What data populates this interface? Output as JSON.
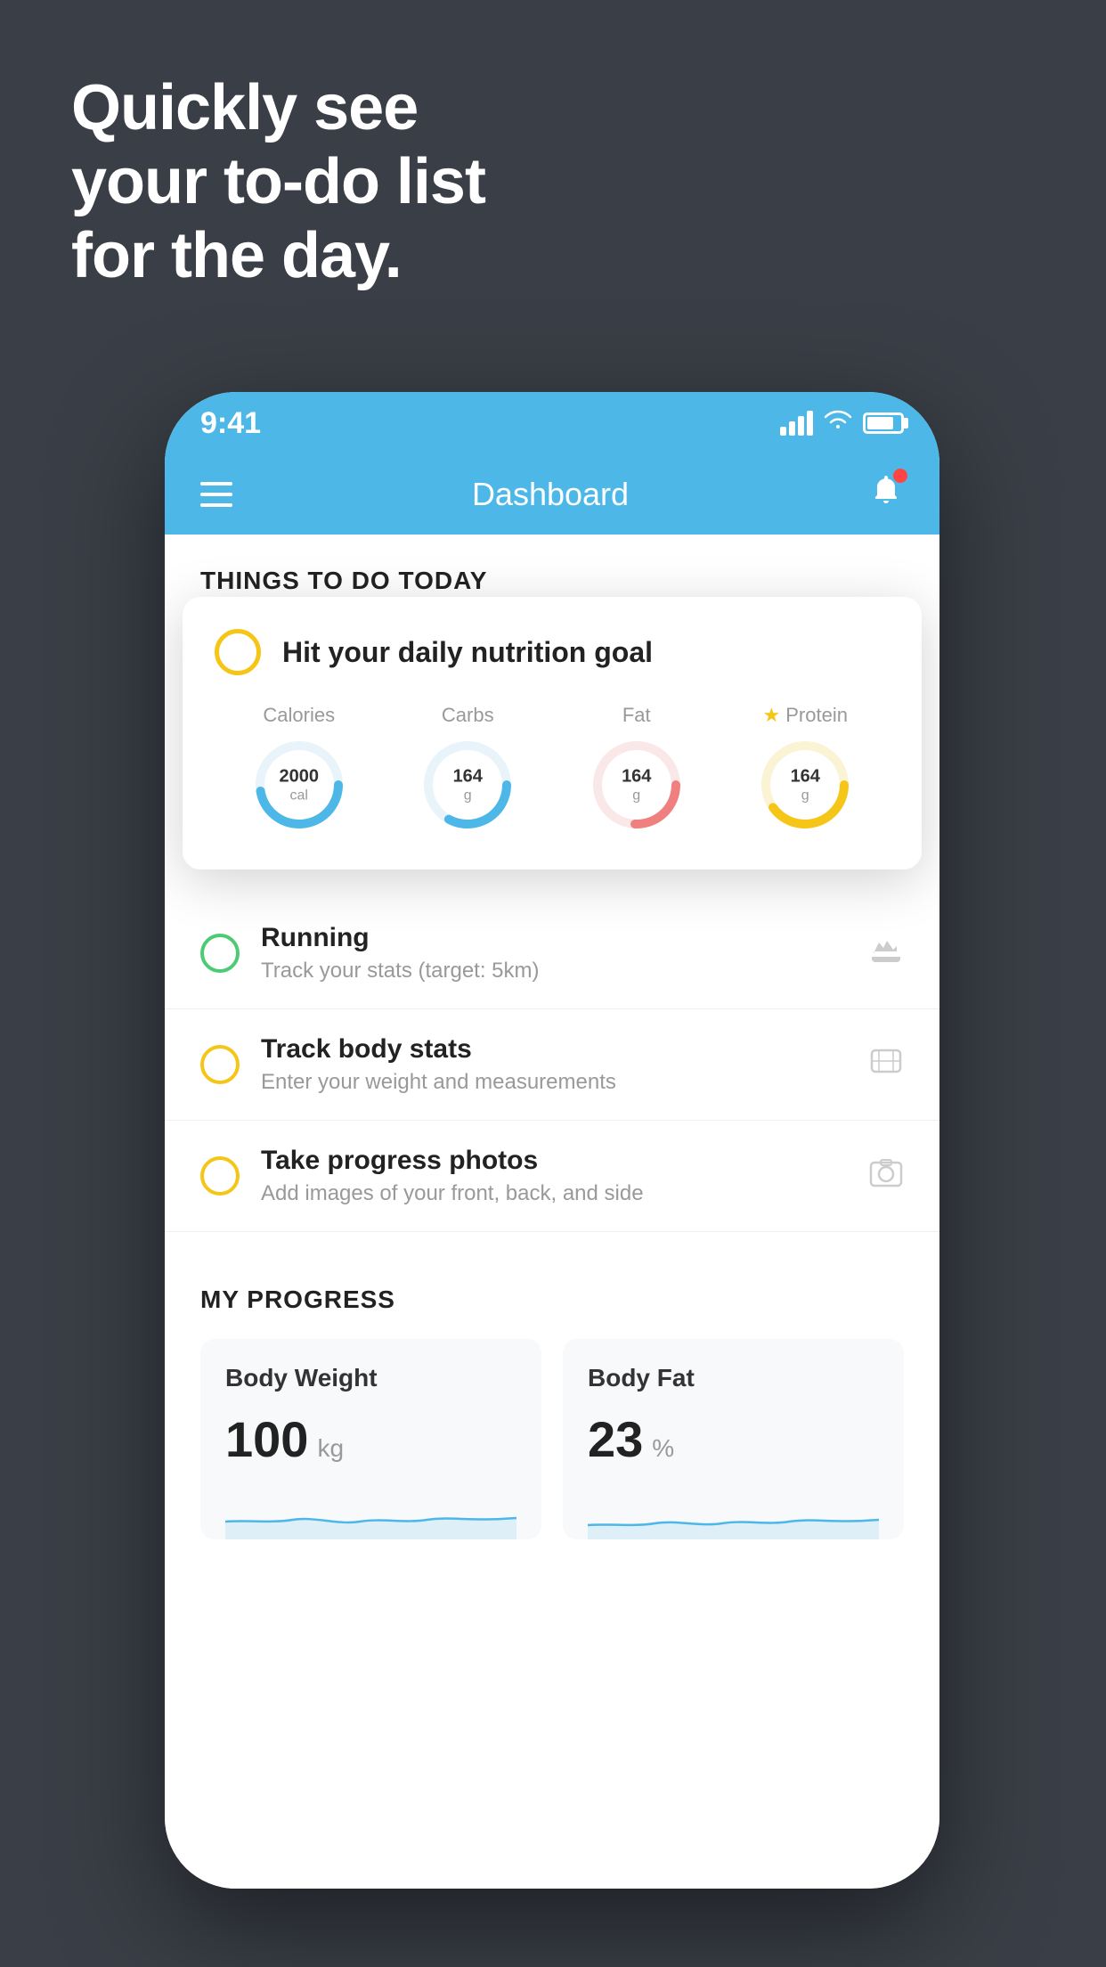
{
  "background_color": "#3a3f47",
  "headline": {
    "line1": "Quickly see",
    "line2": "your to-do list",
    "line3": "for the day."
  },
  "phone": {
    "status_bar": {
      "time": "9:41",
      "signal_label": "signal",
      "wifi_label": "wifi",
      "battery_label": "battery"
    },
    "nav": {
      "title": "Dashboard",
      "menu_label": "menu",
      "bell_label": "notifications"
    },
    "section_title": "THINGS TO DO TODAY",
    "nutrition_card": {
      "circle_label": "incomplete",
      "title": "Hit your daily nutrition goal",
      "stats": [
        {
          "label": "Calories",
          "value": "2000",
          "unit": "cal",
          "color": "#4db8e8",
          "starred": false
        },
        {
          "label": "Carbs",
          "value": "164",
          "unit": "g",
          "color": "#4db8e8",
          "starred": false
        },
        {
          "label": "Fat",
          "value": "164",
          "unit": "g",
          "color": "#f08080",
          "starred": false
        },
        {
          "label": "Protein",
          "value": "164",
          "unit": "g",
          "color": "#f5c518",
          "starred": true
        }
      ]
    },
    "todo_items": [
      {
        "id": "running",
        "title": "Running",
        "subtitle": "Track your stats (target: 5km)",
        "circle_color": "green",
        "icon": "shoe"
      },
      {
        "id": "track-body",
        "title": "Track body stats",
        "subtitle": "Enter your weight and measurements",
        "circle_color": "yellow",
        "icon": "scale"
      },
      {
        "id": "progress-photos",
        "title": "Take progress photos",
        "subtitle": "Add images of your front, back, and side",
        "circle_color": "yellow",
        "icon": "photo"
      }
    ],
    "progress_section": {
      "title": "MY PROGRESS",
      "cards": [
        {
          "id": "body-weight",
          "title": "Body Weight",
          "value": "100",
          "unit": "kg"
        },
        {
          "id": "body-fat",
          "title": "Body Fat",
          "value": "23",
          "unit": "%"
        }
      ]
    }
  }
}
